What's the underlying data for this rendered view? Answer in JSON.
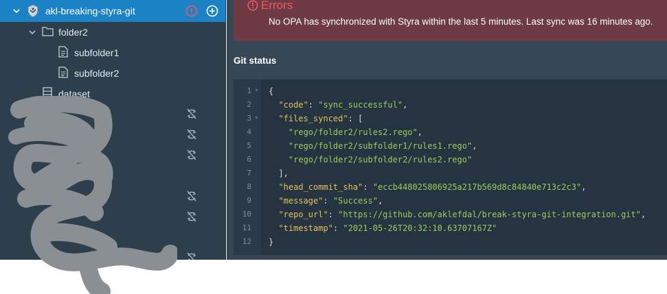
{
  "sidebar": {
    "repo": {
      "name": "akl-breaking-styra-git"
    },
    "tree": [
      {
        "label": "folder2",
        "type": "folder"
      },
      {
        "label": "subfolder1",
        "type": "file"
      },
      {
        "label": "subfolder2",
        "type": "file"
      },
      {
        "label": "dataset",
        "type": "dataset"
      }
    ],
    "sync_icon_name": "sync-disabled-icon"
  },
  "error": {
    "title": "Errors",
    "message": "No OPA has synchronized with Styra within the last 5 minutes. Last sync was 16 minutes ago.",
    "color": "#f1595d"
  },
  "git_status": {
    "title": "Git status",
    "line_numbers": [
      "1",
      "2",
      "3",
      "4",
      "5",
      "6",
      "7",
      "8",
      "9",
      "10",
      "11",
      "12"
    ],
    "lines": [
      {
        "parts": [
          [
            "p",
            "{"
          ]
        ]
      },
      {
        "parts": [
          [
            "k",
            "  \"code\""
          ],
          [
            "p",
            ": "
          ],
          [
            "s",
            "\"sync_successful\""
          ],
          [
            "p",
            ","
          ]
        ]
      },
      {
        "parts": [
          [
            "k",
            "  \"files_synced\""
          ],
          [
            "p",
            ": ["
          ]
        ]
      },
      {
        "parts": [
          [
            "s",
            "    \"rego/folder2/rules2.rego\""
          ],
          [
            "p",
            ","
          ]
        ]
      },
      {
        "parts": [
          [
            "s",
            "    \"rego/folder2/subfolder1/rules1.rego\""
          ],
          [
            "p",
            ","
          ]
        ]
      },
      {
        "parts": [
          [
            "s",
            "    \"rego/folder2/subfolder2/rules2.rego\""
          ]
        ]
      },
      {
        "parts": [
          [
            "p",
            "  ],"
          ]
        ]
      },
      {
        "parts": [
          [
            "k",
            "  \"head_commit_sha\""
          ],
          [
            "p",
            ": "
          ],
          [
            "s",
            "\"eccb448025806925a217b569d8c84840e713c2c3\""
          ],
          [
            "p",
            ","
          ]
        ]
      },
      {
        "parts": [
          [
            "k",
            "  \"message\""
          ],
          [
            "p",
            ": "
          ],
          [
            "s",
            "\"Success\""
          ],
          [
            "p",
            ","
          ]
        ]
      },
      {
        "parts": [
          [
            "k",
            "  \"repo_url\""
          ],
          [
            "p",
            ": "
          ],
          [
            "s",
            "\"https://github.com/aklefdal/break-styra-git-integration.git\""
          ],
          [
            "p",
            ","
          ]
        ]
      },
      {
        "parts": [
          [
            "k",
            "  \"timestamp\""
          ],
          [
            "p",
            ": "
          ],
          [
            "s",
            "\"2021-05-26T20:32:10.63707167Z\""
          ]
        ]
      },
      {
        "parts": [
          [
            "p",
            "}"
          ]
        ]
      }
    ],
    "fold_lines": [
      1,
      3
    ]
  }
}
